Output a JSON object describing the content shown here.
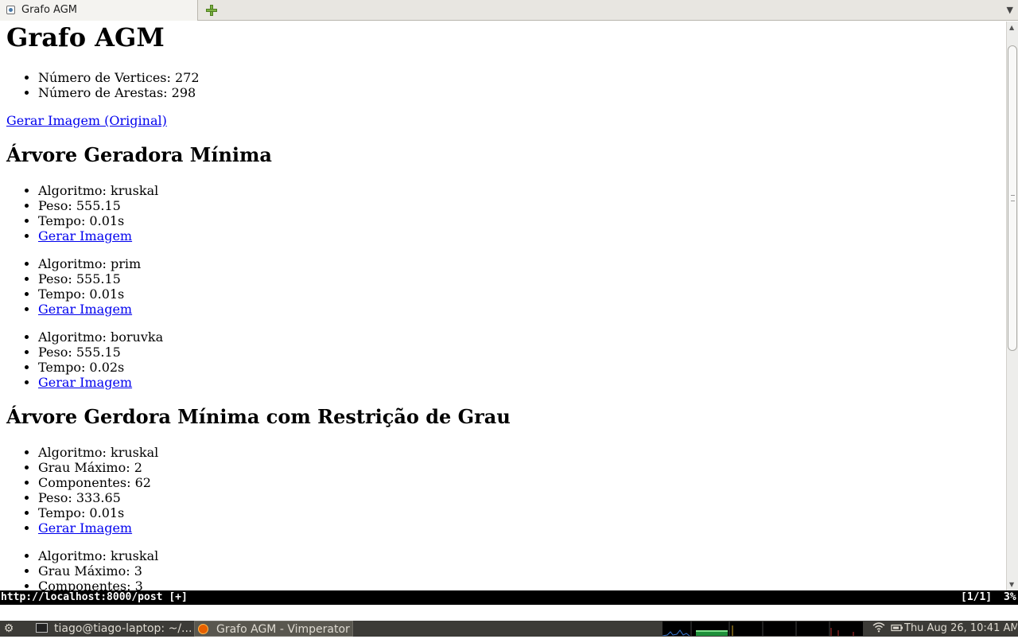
{
  "tab": {
    "title": "Grafo AGM"
  },
  "page": {
    "title": "Grafo AGM",
    "summary": [
      "Número de Vertices: 272",
      "Número de Arestas: 298"
    ],
    "original_image_link": "Gerar Imagem (Original)",
    "mst": {
      "heading": "Árvore Geradora Mínima",
      "groups": [
        [
          "Algoritmo: kruskal",
          "Peso: 555.15",
          "Tempo: 0.01s"
        ],
        [
          "Algoritmo: prim",
          "Peso: 555.15",
          "Tempo: 0.01s"
        ],
        [
          "Algoritmo: boruvka",
          "Peso: 555.15",
          "Tempo: 0.02s"
        ]
      ]
    },
    "dcmst": {
      "heading": "Árvore Gerdora Mínima com Restrição de Grau",
      "group1": [
        "Algoritmo: kruskal",
        "Grau Máximo: 2",
        "Componentes: 62",
        "Peso: 333.65",
        "Tempo: 0.01s"
      ],
      "group2": [
        "Algoritmo: kruskal",
        "Grau Máximo: 3",
        "Componentes: 3"
      ]
    },
    "link_label": "Gerar Imagem"
  },
  "statusline": {
    "url": "http://localhost:8000/post [+]",
    "position": "[1/1]",
    "percent": "3%"
  },
  "taskbar": {
    "terminal": "tiago@tiago-laptop: ~/...",
    "firefox": "Grafo AGM - Vimperator",
    "clock": "Thu Aug 26, 10:41 AM"
  },
  "icons": {
    "tab_favicon": "page-icon",
    "new_tab": "plus-icon",
    "tab_list": "chevron-down-icon",
    "menu": "gear-icon",
    "wifi": "wifi-icon",
    "power": "battery-icon"
  },
  "colors": {
    "link": "#0000ee",
    "statusline_bg": "#000000",
    "taskbar_bg": "#3c3b37",
    "new_tab_green": "#7cb342"
  }
}
